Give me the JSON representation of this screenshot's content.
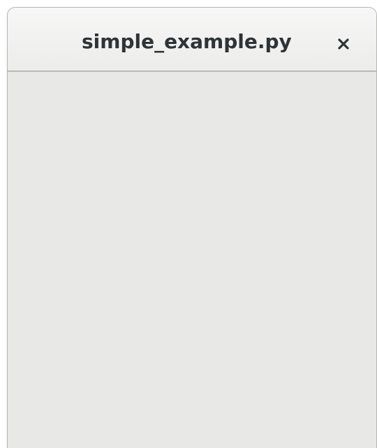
{
  "window": {
    "title": "simple_example.py",
    "close_icon": "close-icon"
  },
  "colors": {
    "titlebar": "#f0f0ef",
    "content_background": "#e8e8e7",
    "title_text": "#2e3436"
  }
}
